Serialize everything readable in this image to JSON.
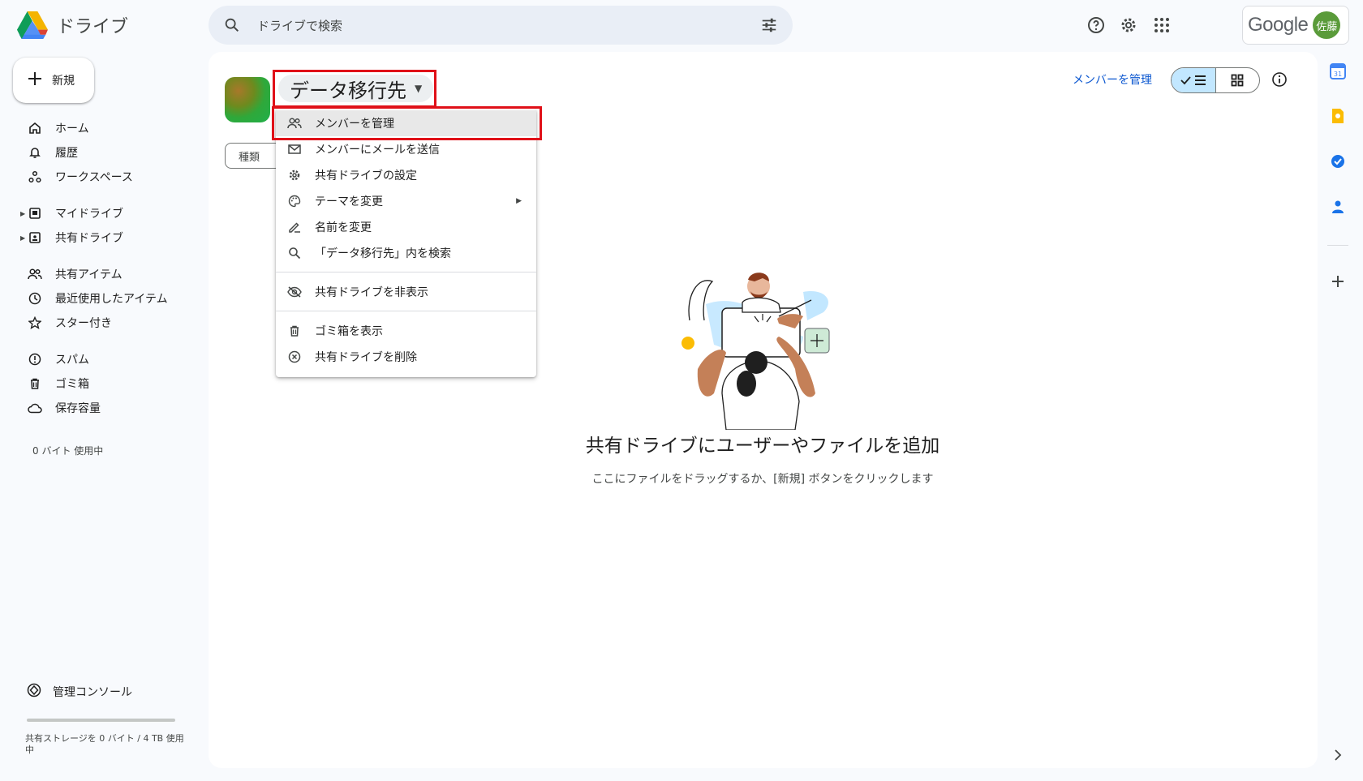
{
  "app": {
    "name": "ドライブ"
  },
  "search": {
    "placeholder": "ドライブで検索"
  },
  "account": {
    "brand": "Google",
    "avatar_text": "佐藤"
  },
  "sidebar": {
    "new_label": "新規",
    "items": [
      {
        "label": "ホーム",
        "icon": "home-icon"
      },
      {
        "label": "履歴",
        "icon": "bell-icon"
      },
      {
        "label": "ワークスペース",
        "icon": "workspace-icon"
      },
      {
        "label": "マイドライブ",
        "icon": "my-drive-icon"
      },
      {
        "label": "共有ドライブ",
        "icon": "shared-drive-icon"
      },
      {
        "label": "共有アイテム",
        "icon": "people-icon"
      },
      {
        "label": "最近使用したアイテム",
        "icon": "clock-icon"
      },
      {
        "label": "スター付き",
        "icon": "star-icon"
      },
      {
        "label": "スパム",
        "icon": "spam-icon"
      },
      {
        "label": "ゴミ箱",
        "icon": "trash-icon"
      },
      {
        "label": "保存容量",
        "icon": "cloud-icon"
      }
    ],
    "storage_used": "0 バイト 使用中",
    "admin_console": "管理コンソール",
    "shared_storage": "共有ストレージを 0 バイト / 4 TB 使用中"
  },
  "header": {
    "drive_title": "データ移行先",
    "filter_type": "種類",
    "manage_members": "メンバーを管理"
  },
  "menu": {
    "items": [
      {
        "label": "メンバーを管理",
        "icon": "people-icon"
      },
      {
        "label": "メンバーにメールを送信",
        "icon": "mail-icon"
      },
      {
        "label": "共有ドライブの設定",
        "icon": "settings-icon"
      },
      {
        "label": "テーマを変更",
        "icon": "palette-icon"
      },
      {
        "label": "名前を変更",
        "icon": "rename-icon"
      },
      {
        "label": "「データ移行先」内を検索",
        "icon": "search-icon"
      },
      {
        "label": "共有ドライブを非表示",
        "icon": "hide-icon"
      },
      {
        "label": "ゴミ箱を表示",
        "icon": "trash-icon"
      },
      {
        "label": "共有ドライブを削除",
        "icon": "delete-icon"
      }
    ]
  },
  "empty_state": {
    "title": "共有ドライブにユーザーやファイルを追加",
    "subtitle": "ここにファイルをドラッグするか、[新規] ボタンをクリックします"
  },
  "colors": {
    "accent": "#0b57d0",
    "highlight_box": "#e01018",
    "toggle_active": "#c2e7ff"
  }
}
